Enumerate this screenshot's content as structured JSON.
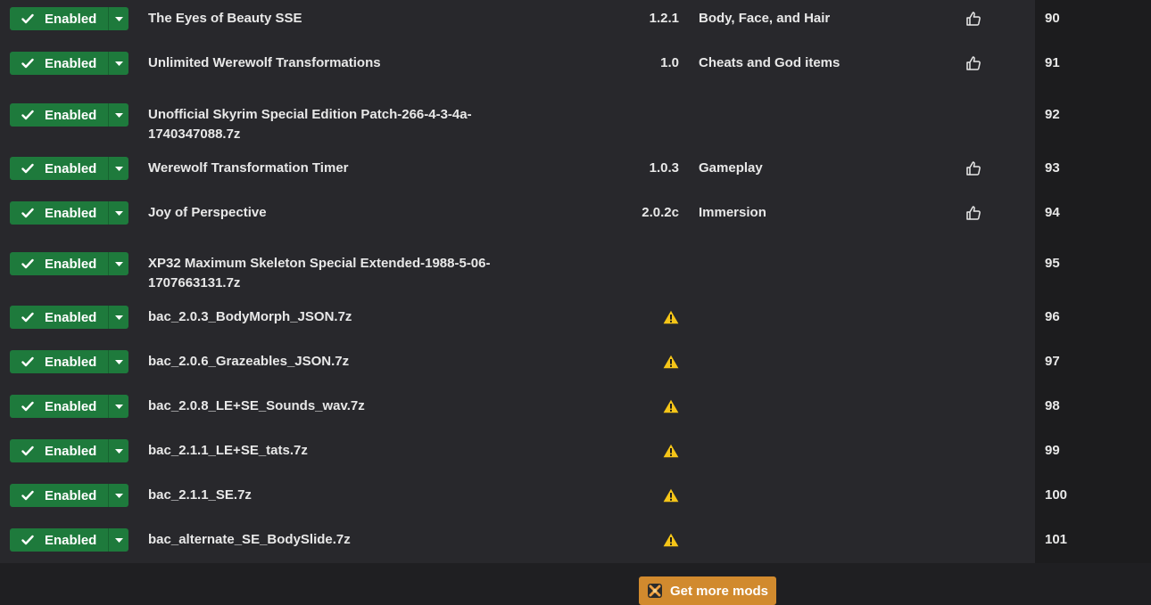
{
  "status_label": "Enabled",
  "colors": {
    "enabled": "#1e7a3c",
    "warning": "#f5c518",
    "get_more": "#d18a2e"
  },
  "mods": [
    {
      "name": "The Eyes of Beauty SSE",
      "version": "1.2.1",
      "category": "Body, Face, and Hair",
      "endorse_icon": "thumbs-up-icon",
      "warning": false,
      "priority": "90"
    },
    {
      "name": "Unlimited Werewolf Transformations",
      "version": "1.0",
      "category": "Cheats and God items",
      "endorse_icon": "thumbs-up-icon",
      "warning": false,
      "priority": "91"
    },
    {
      "name": "Unofficial Skyrim Special Edition Patch-266-4-3-4a-1740347088.7z",
      "version": "",
      "category": "",
      "endorse_icon": "",
      "warning": false,
      "priority": "92"
    },
    {
      "name": "Werewolf Transformation Timer",
      "version": "1.0.3",
      "category": "Gameplay",
      "endorse_icon": "thumbs-up-icon",
      "warning": false,
      "priority": "93"
    },
    {
      "name": "Joy of Perspective",
      "version": "2.0.2c",
      "category": "Immersion",
      "endorse_icon": "thumbs-up-icon",
      "warning": false,
      "priority": "94"
    },
    {
      "name": "XP32 Maximum Skeleton Special Extended-1988-5-06-1707663131.7z",
      "version": "",
      "category": "",
      "endorse_icon": "",
      "warning": false,
      "priority": "95"
    },
    {
      "name": "bac_2.0.3_BodyMorph_JSON.7z",
      "version": "",
      "category": "",
      "endorse_icon": "",
      "warning": true,
      "priority": "96"
    },
    {
      "name": "bac_2.0.6_Grazeables_JSON.7z",
      "version": "",
      "category": "",
      "endorse_icon": "",
      "warning": true,
      "priority": "97"
    },
    {
      "name": "bac_2.0.8_LE+SE_Sounds_wav.7z",
      "version": "",
      "category": "",
      "endorse_icon": "",
      "warning": true,
      "priority": "98"
    },
    {
      "name": "bac_2.1.1_LE+SE_tats.7z",
      "version": "",
      "category": "",
      "endorse_icon": "",
      "warning": true,
      "priority": "99"
    },
    {
      "name": "bac_2.1.1_SE.7z",
      "version": "",
      "category": "",
      "endorse_icon": "",
      "warning": true,
      "priority": "100"
    },
    {
      "name": "bac_alternate_SE_BodySlide.7z",
      "version": "",
      "category": "",
      "endorse_icon": "",
      "warning": true,
      "priority": "101"
    }
  ],
  "footer": {
    "get_more_label": "Get more mods",
    "get_more_icon": "nexus-logo-icon"
  }
}
